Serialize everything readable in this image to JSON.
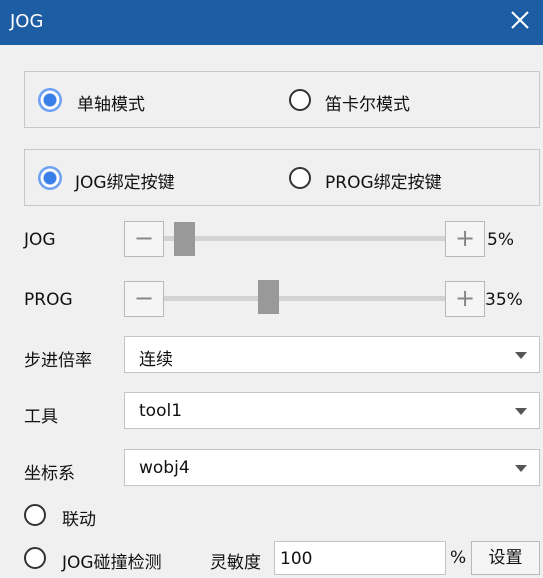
{
  "window": {
    "title": "JOG"
  },
  "mode_group": {
    "options": [
      {
        "label": "单轴模式",
        "selected": true
      },
      {
        "label": "笛卡尔模式",
        "selected": false
      }
    ]
  },
  "binding_group": {
    "options": [
      {
        "label": "JOG绑定按键",
        "selected": true
      },
      {
        "label": "PROG绑定按键",
        "selected": false
      }
    ]
  },
  "sliders": {
    "jog": {
      "label": "JOG",
      "value_percent": 5,
      "display": "5%"
    },
    "prog": {
      "label": "PROG",
      "value_percent": 35,
      "display": "35%"
    },
    "minus_symbol": "−",
    "plus_symbol": "+"
  },
  "selects": {
    "step_rate": {
      "label": "步进倍率",
      "value": "连续"
    },
    "tool": {
      "label": "工具",
      "value": "tool1"
    },
    "coord": {
      "label": "坐标系",
      "value": "wobj4"
    }
  },
  "linkage": {
    "label": "联动",
    "checked": false
  },
  "collision": {
    "label": "JOG碰撞检测",
    "checked": false,
    "sensitivity_label": "灵敏度",
    "sensitivity_value": "100",
    "unit": "%",
    "set_button": "设置"
  },
  "colors": {
    "titlebar": "#1c5da4",
    "accent": "#3a7fe8",
    "background": "#f0f0f0"
  }
}
